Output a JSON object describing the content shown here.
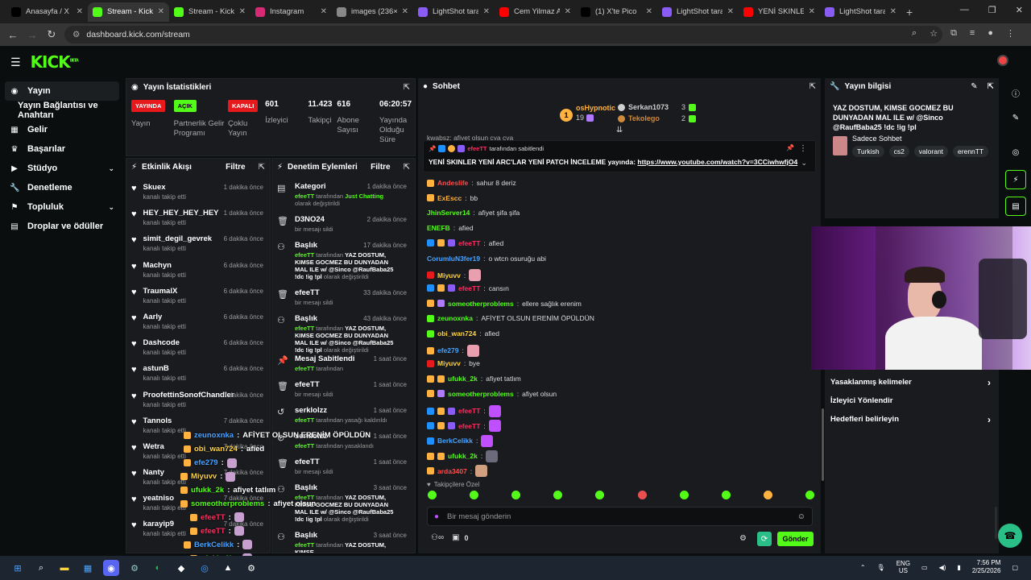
{
  "browser": {
    "tabs": [
      {
        "title": "Anasayfa / X",
        "color": "#000000",
        "icon": "x-icon"
      },
      {
        "title": "Stream - Kick D",
        "color": "#53fc18",
        "icon": "kick-icon",
        "active": true
      },
      {
        "title": "Stream - Kick D",
        "color": "#53fc18",
        "icon": "kick-icon"
      },
      {
        "title": "Instagram",
        "color": "#d62976",
        "icon": "instagram-icon"
      },
      {
        "title": "images (236×2",
        "color": "#888888",
        "icon": "globe-icon"
      },
      {
        "title": "LightShot taraf",
        "color": "#8a5cf6",
        "icon": "feather-icon"
      },
      {
        "title": "Cem Yilmaz Ar",
        "color": "#ff0000",
        "icon": "youtube-icon"
      },
      {
        "title": "(1) X'te Pico",
        "color": "#000000",
        "icon": "x-icon"
      },
      {
        "title": "LightShot taraf",
        "color": "#8a5cf6",
        "icon": "feather-icon"
      },
      {
        "title": "YENİ SKINLER",
        "color": "#ff0000",
        "icon": "youtube-icon"
      },
      {
        "title": "LightShot taraf",
        "color": "#8a5cf6",
        "icon": "feather-icon"
      }
    ],
    "url": "dashboard.kick.com/stream"
  },
  "sidebar": {
    "items": [
      {
        "label": "Yayın",
        "icon": "broadcast-icon",
        "active": true
      },
      {
        "label": "Yayın Bağlantısı ve Anahtarı",
        "icon": ""
      },
      {
        "label": "Gelir",
        "icon": "revenue-icon"
      },
      {
        "label": "Başarılar",
        "icon": "trophy-icon"
      },
      {
        "label": "Stüdyo",
        "icon": "studio-icon",
        "expandable": true
      },
      {
        "label": "Denetleme",
        "icon": "wrench-icon"
      },
      {
        "label": "Topluluk",
        "icon": "community-icon",
        "expandable": true
      },
      {
        "label": "Droplar ve ödüller",
        "icon": "drops-icon"
      }
    ]
  },
  "stats": {
    "title": "Yayın İstatistikleri",
    "cols": [
      {
        "badge": "YAYINDA",
        "label": "Yayın"
      },
      {
        "badge": "AÇIK",
        "label": "Partnerlik Gelir Programı"
      },
      {
        "badge": "KAPALI",
        "label": "Çoklu Yayın"
      },
      {
        "num": "601",
        "label": "İzleyici"
      },
      {
        "num": "11.423",
        "label": "Takipçi"
      },
      {
        "num": "616",
        "label": "Abone Sayısı"
      },
      {
        "num": "06:20:57",
        "label": "Yayında Olduğu Süre"
      }
    ]
  },
  "activity": {
    "title": "Etkinlik Akışı",
    "filter": "Filtre",
    "items": [
      {
        "name": "Skuex",
        "sub": "kanalı takip etti",
        "time": "1 dakika önce"
      },
      {
        "name": "HEY_HEY_HEY_HEY",
        "sub": "kanalı takip etti",
        "time": "1 dakika önce"
      },
      {
        "name": "simit_degil_gevrek",
        "sub": "kanalı takip etti",
        "time": "6 dakika önce"
      },
      {
        "name": "Machyn",
        "sub": "kanalı takip etti",
        "time": "6 dakika önce"
      },
      {
        "name": "TraumalX",
        "sub": "kanalı takip etti",
        "time": "6 dakika önce"
      },
      {
        "name": "Aarly",
        "sub": "kanalı takip etti",
        "time": "6 dakika önce"
      },
      {
        "name": "Dashcode",
        "sub": "kanalı takip etti",
        "time": "6 dakika önce"
      },
      {
        "name": "astunB",
        "sub": "kanalı takip etti",
        "time": "6 dakika önce"
      },
      {
        "name": "ProofettinSonofChandler",
        "sub": "kanalı takip etti",
        "time": "7 dakika önce"
      },
      {
        "name": "Tannols",
        "sub": "kanalı takip etti",
        "time": "7 dakika önce"
      },
      {
        "name": "Wetra",
        "sub": "kanalı takip etti",
        "time": "7 dakika önce"
      },
      {
        "name": "Nanty",
        "sub": "kanalı takip etti",
        "time": "7 dakika önce"
      },
      {
        "name": "yeatniso",
        "sub": "kanalı takip etti",
        "time": "7 dakika önce"
      },
      {
        "name": "karayip9",
        "sub": "kanalı takip etti",
        "time": "7 dakika önce"
      }
    ]
  },
  "moderation": {
    "title": "Denetim Eylemleri",
    "filter": "Filtre",
    "items": [
      {
        "icon": "category-icon",
        "title": "Kategori",
        "sub_pre": "efeeTT",
        "sub": " tarafından ",
        "highlight": "Just Chatting",
        "sub_post": " olarak değiştirildi",
        "time": "1 dakika önce",
        "h": 41
      },
      {
        "icon": "trash-icon",
        "title": "D3NO24",
        "sub_pre": "",
        "sub": "bir mesajı sildi",
        "highlight": "",
        "sub_post": "",
        "time": "2 dakika önce",
        "h": 32
      },
      {
        "icon": "title-icon",
        "title": "Başlık",
        "sub_pre": "efeeTT",
        "sub": " tarafından ",
        "highlight": "YAZ DOSTUM, KIMSE GOCMEZ BU DUNYADAN MAL ILE w/ @Sinco @RaufBaba25 !dc !ig !pl",
        "sub_post": " olarak değiştirildi",
        "time": "17 dakika önce",
        "h": 59
      },
      {
        "icon": "trash-icon",
        "title": "efeeTT",
        "sub_pre": "",
        "sub": "bir mesajı sildi",
        "highlight": "",
        "sub_post": "",
        "time": "33 dakika önce",
        "h": 32
      },
      {
        "icon": "title-icon",
        "title": "Başlık",
        "sub_pre": "efeeTT",
        "sub": " tarafından ",
        "highlight": "YAZ DOSTUM, KIMSE GOCMEZ BU DUNYADAN MAL ILE w/ @Sinco @RaufBaba25 !dc !ig !pl",
        "sub_post": " olarak değiştirildi",
        "time": "43 dakika önce",
        "h": 50
      },
      {
        "icon": "pin-icon",
        "title": "Mesaj Sabitlendi",
        "sub_pre": "efeeTT",
        "sub": " tarafından",
        "highlight": "",
        "sub_post": "",
        "time": "1 saat önce",
        "h": 32
      },
      {
        "icon": "trash-icon",
        "title": "efeeTT",
        "sub_pre": "",
        "sub": "bir mesajı sildi",
        "highlight": "",
        "sub_post": "",
        "time": "1 saat önce",
        "h": 32
      },
      {
        "icon": "undo-icon",
        "title": "serklolzz",
        "sub_pre": "efeeTT",
        "sub": " tarafından yasağı kaldırıldı",
        "highlight": "",
        "sub_post": "",
        "time": "1 saat önce",
        "h": 32
      },
      {
        "icon": "ban-icon",
        "title": "serklolzz",
        "sub_pre": "efeeTT",
        "sub": " tarafından yasaklandı",
        "highlight": "",
        "sub_post": "",
        "time": "1 saat önce",
        "h": 32
      },
      {
        "icon": "trash-icon",
        "title": "efeeTT",
        "sub_pre": "",
        "sub": "bir mesajı sildi",
        "highlight": "",
        "sub_post": "",
        "time": "1 saat önce",
        "h": 32
      },
      {
        "icon": "title-icon",
        "title": "Başlık",
        "sub_pre": "efeeTT",
        "sub": " tarafından ",
        "highlight": "YAZ DOSTUM, KIMSE GOCMEZ BU DUNYADAN MAL ILE w/ @Sinco @RaufBaba25 !dc !ig !pl",
        "sub_post": " olarak değiştirildi",
        "time": "3 saat önce",
        "h": 59
      },
      {
        "icon": "title-icon",
        "title": "Başlık",
        "sub_pre": "efeeTT",
        "sub": " tarafından ",
        "highlight": "YAZ DOSTUM, KIMSE",
        "sub_post": "",
        "time": "3 saat önce",
        "h": 30
      }
    ]
  },
  "chat": {
    "title": "Sohbet",
    "leaders": [
      {
        "name": "osHypnotic",
        "count": "19",
        "rank": "1",
        "color": "#ffb23f"
      },
      {
        "name": "Serkan1073",
        "count": "3",
        "rank": "2",
        "color": "#cfcfcf"
      },
      {
        "name": "Tekolego",
        "count": "2",
        "rank": "3",
        "color": "#d08a3a"
      }
    ],
    "cut_line": "kwabsz: afiyet olsun cya cya",
    "pinned": {
      "by": "efeeTT",
      "by_text": "tarafından sabitlendi",
      "message": "YENİ SKINLER YENİ ARC'LAR YENİ PATCH İNCELEME yayında: ",
      "link": "https://www.youtube.com/watch?v=3CCiwhwfjO4"
    },
    "messages": [
      {
        "user": "Andeslife",
        "color": "#ff4d4d",
        "text": "sahur 8 deriz",
        "badges": [
          "#ffb23f"
        ]
      },
      {
        "user": "ExEscc",
        "color": "#ffb23f",
        "text": "bb",
        "badges": [
          "#ffb23f"
        ]
      },
      {
        "user": "JhinServer14",
        "color": "#53fc18",
        "text": "afiyet şifa şifa",
        "badges": []
      },
      {
        "user": "ENEFB",
        "color": "#53fc18",
        "text": "afied",
        "badges": []
      },
      {
        "user": "efeeTT",
        "color": "#ff3060",
        "text": "afied",
        "badges": [
          "#1e90ff",
          "#ffb23f",
          "#8a5cf6"
        ]
      },
      {
        "user": "CorumluN3fer19",
        "color": "#4aa3ff",
        "text": "o wtcn osuruğu abi",
        "badges": []
      },
      {
        "user": "Miyuvv",
        "color": "#ffd23f",
        "text": "",
        "emote": "#e8a0b0",
        "badges": [
          "#e8191d"
        ]
      },
      {
        "user": "efeeTT",
        "color": "#ff3060",
        "text": "cansın",
        "badges": [
          "#1e90ff",
          "#ffb23f",
          "#8a5cf6"
        ]
      },
      {
        "user": "someotherproblems",
        "color": "#53fc18",
        "text": "ellere sağlık erenim",
        "badges": [
          "#ffb23f",
          "#b07aff"
        ]
      },
      {
        "user": "zeunoxnka",
        "color": "#53fc18",
        "text": "AFİYET OLSUN ERENİM ÖPÜLDÜN",
        "badges": [
          "#53fc18"
        ]
      },
      {
        "user": "obi_wan724",
        "color": "#ffd23f",
        "text": "afied",
        "badges": [
          "#53fc18"
        ]
      },
      {
        "user": "efe279",
        "color": "#4aa3ff",
        "text": "",
        "emote": "#e8a0b0",
        "badges": [
          "#ffb23f"
        ]
      },
      {
        "user": "Miyuvv",
        "color": "#ffd23f",
        "text": "bye",
        "badges": [
          "#e8191d"
        ]
      },
      {
        "user": "ufukk_2k",
        "color": "#53fc18",
        "text": "afiyet tatlım",
        "badges": [
          "#ffb23f",
          "#ffb23f"
        ]
      },
      {
        "user": "someotherproblems",
        "color": "#53fc18",
        "text": "afiyet olsun",
        "badges": [
          "#ffb23f",
          "#b07aff"
        ]
      },
      {
        "user": "efeeTT",
        "color": "#ff3060",
        "text": "",
        "emote": "#c050ff",
        "badges": [
          "#1e90ff",
          "#ffb23f",
          "#8a5cf6"
        ]
      },
      {
        "user": "efeeTT",
        "color": "#ff3060",
        "text": "",
        "emote": "#c050ff",
        "badges": [
          "#1e90ff",
          "#ffb23f",
          "#8a5cf6"
        ]
      },
      {
        "user": "BerkCelikk",
        "color": "#4aa3ff",
        "text": "",
        "emote": "#c050ff",
        "badges": [
          "#1e90ff"
        ]
      },
      {
        "user": "ufukk_2k",
        "color": "#53fc18",
        "text": "",
        "emote": "#6a6a7a",
        "badges": [
          "#ffb23f",
          "#ffb23f"
        ]
      },
      {
        "user": "arda3407",
        "color": "#ff4d4d",
        "text": "",
        "emote": "#d0a080",
        "badges": [
          "#ffb23f"
        ]
      }
    ],
    "special": "Takipçilere Özel",
    "emotes": [
      "#53fc18",
      "#53fc18",
      "#53fc18",
      "#53fc18",
      "#53fc18",
      "#e85050",
      "#53fc18",
      "#53fc18",
      "#ffb23f",
      "#53fc18"
    ],
    "input_placeholder": "Bir mesaj gönderin",
    "points": "0",
    "send": "Gönder"
  },
  "info": {
    "title": "Yayın bilgisi",
    "stream_title": "YAZ DOSTUM, KIMSE GOCMEZ BU DUNYADAN MAL ILE w/ @Sinco @RaufBaba25 !dc !ig !pl",
    "category": "Sadece Sohbet",
    "tags": [
      "Turkish",
      "cs2",
      "valorant",
      "erennTT"
    ]
  },
  "settings": {
    "items": [
      {
        "label": "Yasaklanmış kelimeler",
        "arrow": true
      },
      {
        "label": "İzleyici Yönlendir",
        "arrow": false
      },
      {
        "label": "Hedefleri belirleyin",
        "arrow": true
      }
    ]
  },
  "overlay": {
    "lines": [
      {
        "user": "zeunoxnka",
        "color": "#4aa3ff",
        "text": "AFİYET OLSUN ERENİM ÖPÜLDÜN"
      },
      {
        "user": "obi_wan724",
        "color": "#ffd23f",
        "text": "afied"
      },
      {
        "user": "efe279",
        "color": "#4aa3ff",
        "text": ""
      },
      {
        "user": "Miyuvv",
        "color": "#ffd23f",
        "text": ""
      },
      {
        "user": "ufukk_2k",
        "color": "#53fc18",
        "text": "afiyet tatlım"
      },
      {
        "user": "someotherproblems",
        "color": "#53fc18",
        "text": "afiyet olsun"
      },
      {
        "user": "efeeTT",
        "color": "#ff3060",
        "text": ""
      },
      {
        "user": "efeeTT",
        "color": "#ff3060",
        "text": ""
      },
      {
        "user": "BerkCelikk",
        "color": "#4aa3ff",
        "text": ""
      },
      {
        "user": "ufukk_2k",
        "color": "#53fc18",
        "text": ""
      },
      {
        "user": "arda3407",
        "color": "#ff4d4d",
        "text": ""
      }
    ]
  },
  "taskbar": {
    "lang": "ENG",
    "region": "US",
    "time": "7:56 PM",
    "date": "2/25/2026"
  }
}
